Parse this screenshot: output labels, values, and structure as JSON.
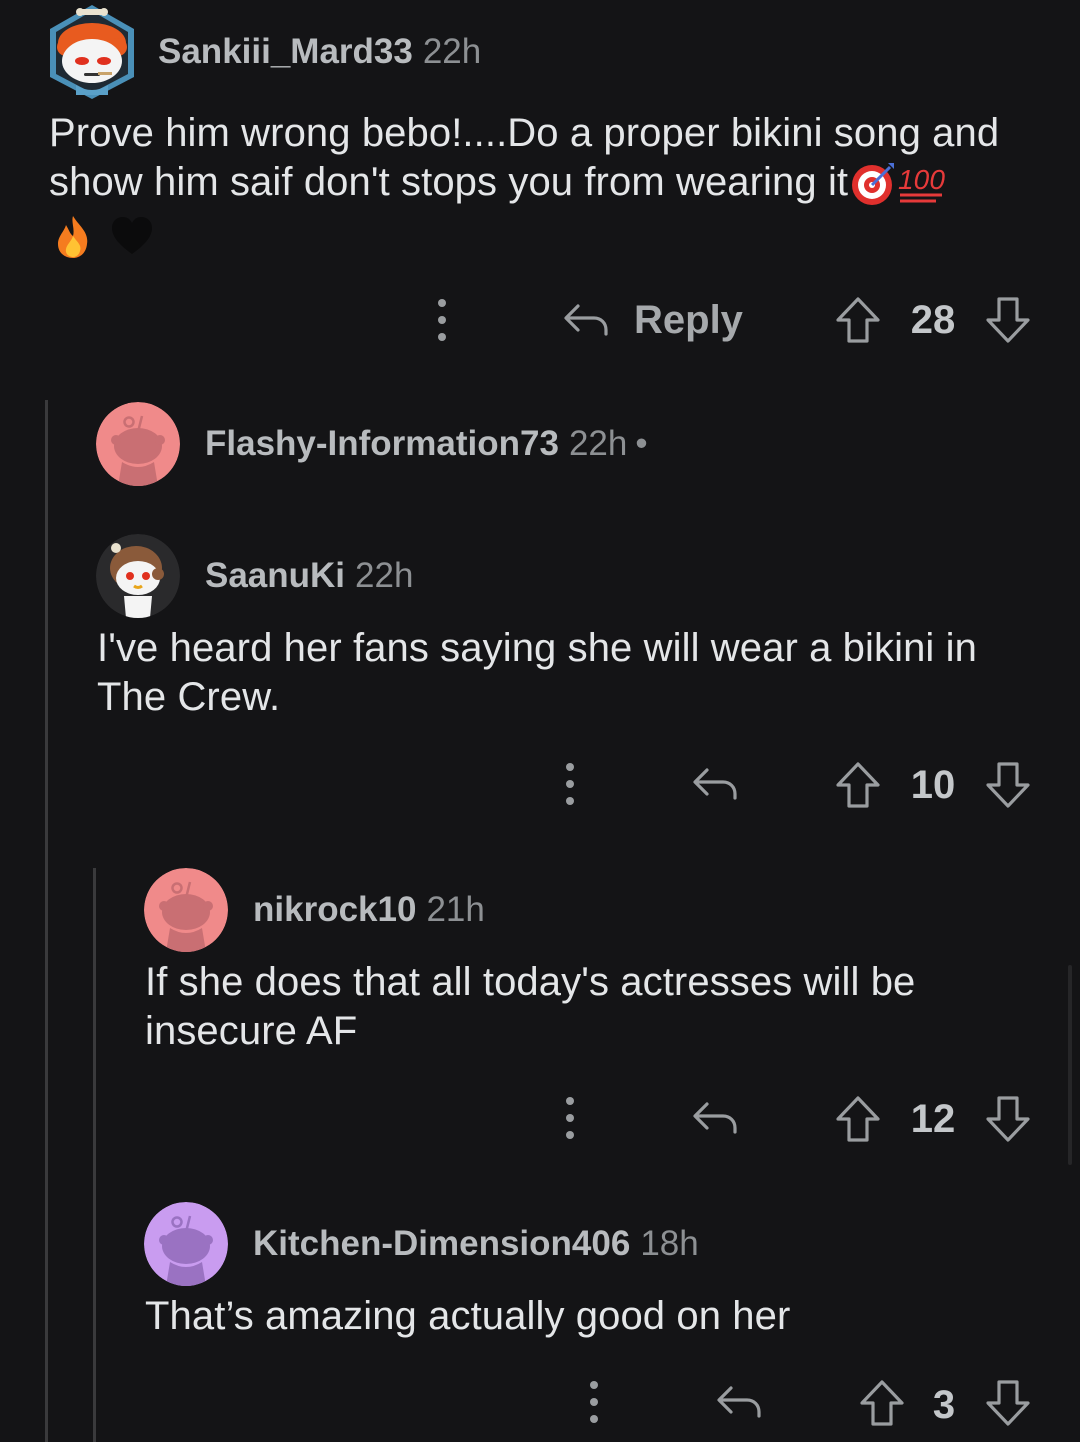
{
  "comments": [
    {
      "username": "Sankiii_Mard33",
      "time": "22h",
      "body_line1": "Prove him wrong bebo!....Do a proper bikini song and",
      "body_line2": "show him saif don't stops you from wearing it",
      "score": "28",
      "reply_label": "Reply",
      "avatar": "custom-snoo-orange-hair-avatar",
      "emojis": [
        "direct-hit-emoji",
        "hundred-points-emoji",
        "fire-emoji",
        "black-heart-emoji"
      ]
    },
    {
      "username": "Flashy-Information73",
      "time": "22h",
      "dot": "•",
      "avatar": "default-snoo-avatar",
      "avatar_color": "#f08a8a"
    },
    {
      "username": "SaanuKi",
      "time": "22h",
      "body_line1": "I've heard her fans saying she will wear a bikini in",
      "body_line2": "The Crew.",
      "score": "10",
      "avatar": "custom-snoo-owl-hat-avatar"
    },
    {
      "username": "nikrock10",
      "time": "21h",
      "body_line1": "If she does that all today's actresses will be",
      "body_line2": "insecure AF",
      "score": "12",
      "avatar": "default-snoo-avatar",
      "avatar_color": "#f08a8a"
    },
    {
      "username": "Kitchen-Dimension406",
      "time": "18h",
      "body_line1": "That’s amazing actually good on her",
      "score": "3",
      "avatar": "default-snoo-avatar",
      "avatar_color": "#c99cf0"
    }
  ],
  "colors": {
    "background": "#141416",
    "text": "#e4e6e8",
    "username": "#b8bbbe",
    "meta": "#8d9093",
    "icon": "#9a9da0",
    "thread_line": "#3a3a3c"
  }
}
